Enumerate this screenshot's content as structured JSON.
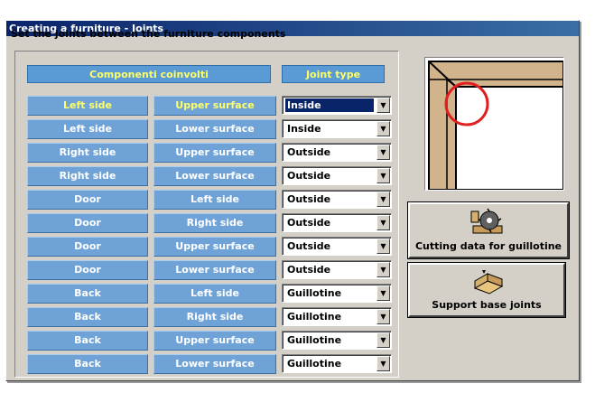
{
  "window": {
    "title": "Creating a furniture - Joints"
  },
  "instruction": "Set the joints between the furniture components",
  "headers": {
    "components": "Componenti coinvolti",
    "joint_type": "Joint type"
  },
  "rows": [
    {
      "a": "Left side",
      "b": "Upper surface",
      "joint": "Inside",
      "selected": true
    },
    {
      "a": "Left side",
      "b": "Lower surface",
      "joint": "Inside"
    },
    {
      "a": "Right side",
      "b": "Upper surface",
      "joint": "Outside"
    },
    {
      "a": "Right side",
      "b": "Lower surface",
      "joint": "Outside"
    },
    {
      "a": "Door",
      "b": "Left side",
      "joint": "Outside"
    },
    {
      "a": "Door",
      "b": "Right side",
      "joint": "Outside"
    },
    {
      "a": "Door",
      "b": "Upper surface",
      "joint": "Outside"
    },
    {
      "a": "Door",
      "b": "Lower surface",
      "joint": "Outside"
    },
    {
      "a": "Back",
      "b": "Left side",
      "joint": "Guillotine"
    },
    {
      "a": "Back",
      "b": "Right side",
      "joint": "Guillotine"
    },
    {
      "a": "Back",
      "b": "Upper surface",
      "joint": "Guillotine"
    },
    {
      "a": "Back",
      "b": "Lower surface",
      "joint": "Guillotine"
    }
  ],
  "buttons": {
    "cutting": {
      "label": "Cutting data for guillotine",
      "icon": "saw-blade-icon"
    },
    "support": {
      "label": "Support base joints",
      "icon": "base-joint-icon"
    }
  },
  "colors": {
    "cell_bg": "#6fa3d8",
    "header_text": "#ffff66",
    "highlight_circle": "#e02020"
  }
}
